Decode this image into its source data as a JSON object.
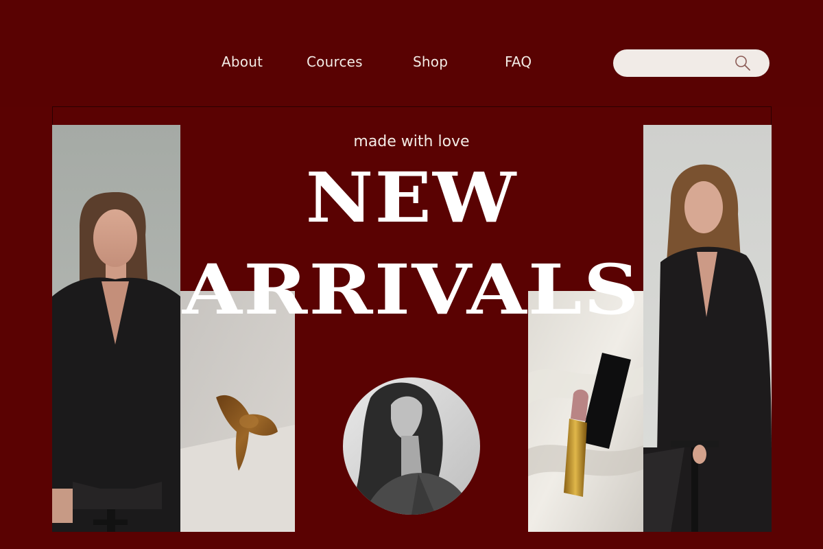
{
  "nav": {
    "items": [
      {
        "label": "About"
      },
      {
        "label": "Cources"
      },
      {
        "label": "Shop"
      },
      {
        "label": "FAQ"
      }
    ]
  },
  "search": {
    "value": "",
    "placeholder": "",
    "icon": "search-icon"
  },
  "hero": {
    "tagline": "made with love",
    "headline_line1": "NEW",
    "headline_line2": "ARRIVALS"
  },
  "images": {
    "left": "woman-in-black-blazer",
    "center_left": "hair-claw-clip",
    "center": "woman-portrait-monochrome",
    "center_right": "lipstick-on-satin",
    "right": "woman-in-black-suit"
  },
  "colors": {
    "background": "#5a0202",
    "text": "#f3ece6",
    "headline": "#ffffff",
    "search_bg": "#f1ebe7"
  }
}
